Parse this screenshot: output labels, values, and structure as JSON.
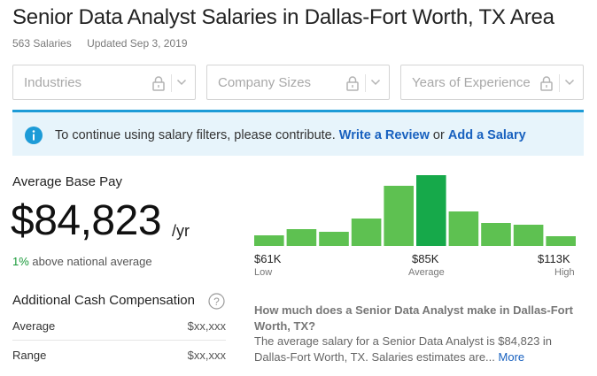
{
  "header": {
    "title": "Senior Data Analyst Salaries in Dallas-Fort Worth, TX Area",
    "salary_count": "563 Salaries",
    "updated": "Updated Sep 3, 2019"
  },
  "filters": [
    {
      "label": "Industries",
      "icon": "lock-icon"
    },
    {
      "label": "Company Sizes",
      "icon": "lock-icon"
    },
    {
      "label": "Years of Experience",
      "icon": "lock-icon"
    }
  ],
  "banner": {
    "text": "To continue using salary filters, please contribute.",
    "review_link": "Write a Review",
    "or": "or",
    "salary_link": "Add a Salary",
    "accent_color": "#1d9bd7",
    "background_color": "#e7f4fb"
  },
  "pay": {
    "label": "Average Base Pay",
    "value": "$84,823",
    "unit": "/yr",
    "compare_pct": "1%",
    "compare_text": "above national average"
  },
  "cash": {
    "title": "Additional Cash Compensation",
    "rows": [
      {
        "label": "Average",
        "value": "$xx,xxx"
      },
      {
        "label": "Range",
        "value": "$xx,xxx"
      }
    ]
  },
  "chart_data": {
    "type": "bar",
    "values": [
      12,
      19,
      16,
      31,
      68,
      80,
      39,
      26,
      24,
      11
    ],
    "highlight_index": 5,
    "colors": {
      "bar": "#5ec151",
      "highlight": "#16a94a"
    },
    "ticks": [
      {
        "value": "$61K",
        "sub": "Low"
      },
      {
        "value": "$85K",
        "sub": "Average"
      },
      {
        "value": "$113K",
        "sub": "High"
      }
    ]
  },
  "faq": {
    "question": "How much does a Senior Data Analyst make in Dallas-Fort Worth, TX?",
    "answer": "The average salary for a Senior Data Analyst is $84,823 in Dallas-Fort Worth, TX. Salaries estimates are...",
    "more": "More"
  }
}
